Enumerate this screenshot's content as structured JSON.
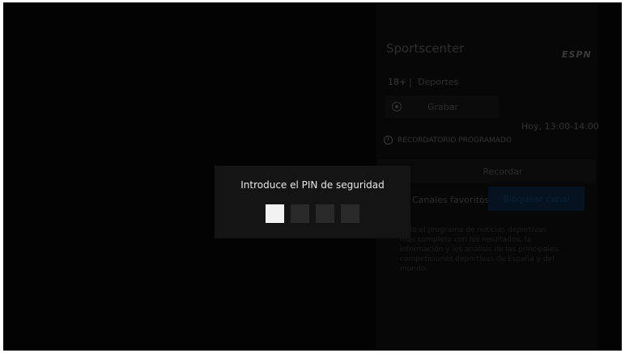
{
  "program": {
    "title": "Sportscenter",
    "channel_logo": "ESPN",
    "rating": "18+",
    "separator": "|",
    "genre": "Deportes",
    "record_label": "Grabar",
    "time": "Hoy, 13:00-14:00",
    "reminder_status": "RECORDATORIO PROGRAMADO",
    "remind_label": "Recordar",
    "favorites_label": "Canales favoritos",
    "block_channel_label": "Bloquear canal",
    "description": "Todo el programa de noticias deportivas más completo con los resultados, la información y los análisis de las principales competiciones deportivas de España y del mundo."
  },
  "pin_dialog": {
    "title": "Introduce el PIN de seguridad",
    "digits_total": 4,
    "digits_entered": 0
  },
  "colors": {
    "background": "#030303",
    "dialog": "#141414",
    "pin_active": "#f2f2f2",
    "pin_inactive": "#2a2a2a",
    "block_button": "#05121f"
  },
  "icons": {
    "record": "record-icon",
    "alarm": "alarm-clock-icon"
  }
}
